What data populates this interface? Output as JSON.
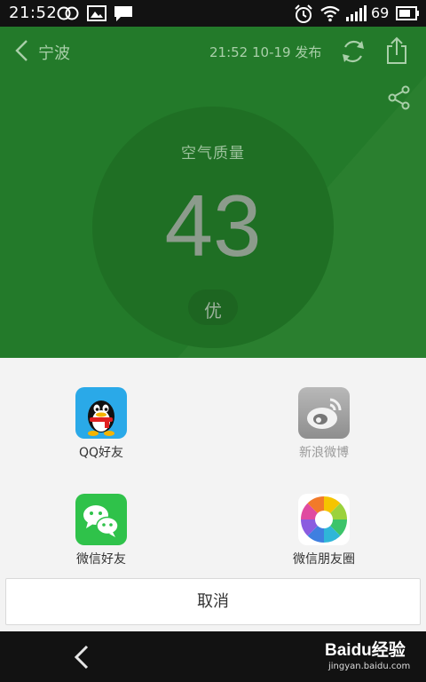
{
  "status_bar": {
    "time": "21:52",
    "battery": "69"
  },
  "header": {
    "city": "宁波",
    "publish_time": "21:52 10-19 发布"
  },
  "aqi": {
    "label": "空气质量",
    "value": "43",
    "level": "优"
  },
  "share_sheet": {
    "items": [
      {
        "label": "QQ好友",
        "icon": "qq-icon",
        "enabled": true
      },
      {
        "label": "新浪微博",
        "icon": "weibo-icon",
        "enabled": false
      },
      {
        "label": "微信好友",
        "icon": "wechat-icon",
        "enabled": true
      },
      {
        "label": "微信朋友圈",
        "icon": "wechat-moments-icon",
        "enabled": true
      }
    ],
    "cancel_label": "取消"
  },
  "watermark": {
    "brand": "Baidu经验",
    "url": "jingyan.baidu.com"
  },
  "colors": {
    "app_green": "#237a2a",
    "sheet_bg": "#f3f3f3",
    "qq_blue": "#2aa9e8",
    "wechat_green": "#2fc24a"
  }
}
